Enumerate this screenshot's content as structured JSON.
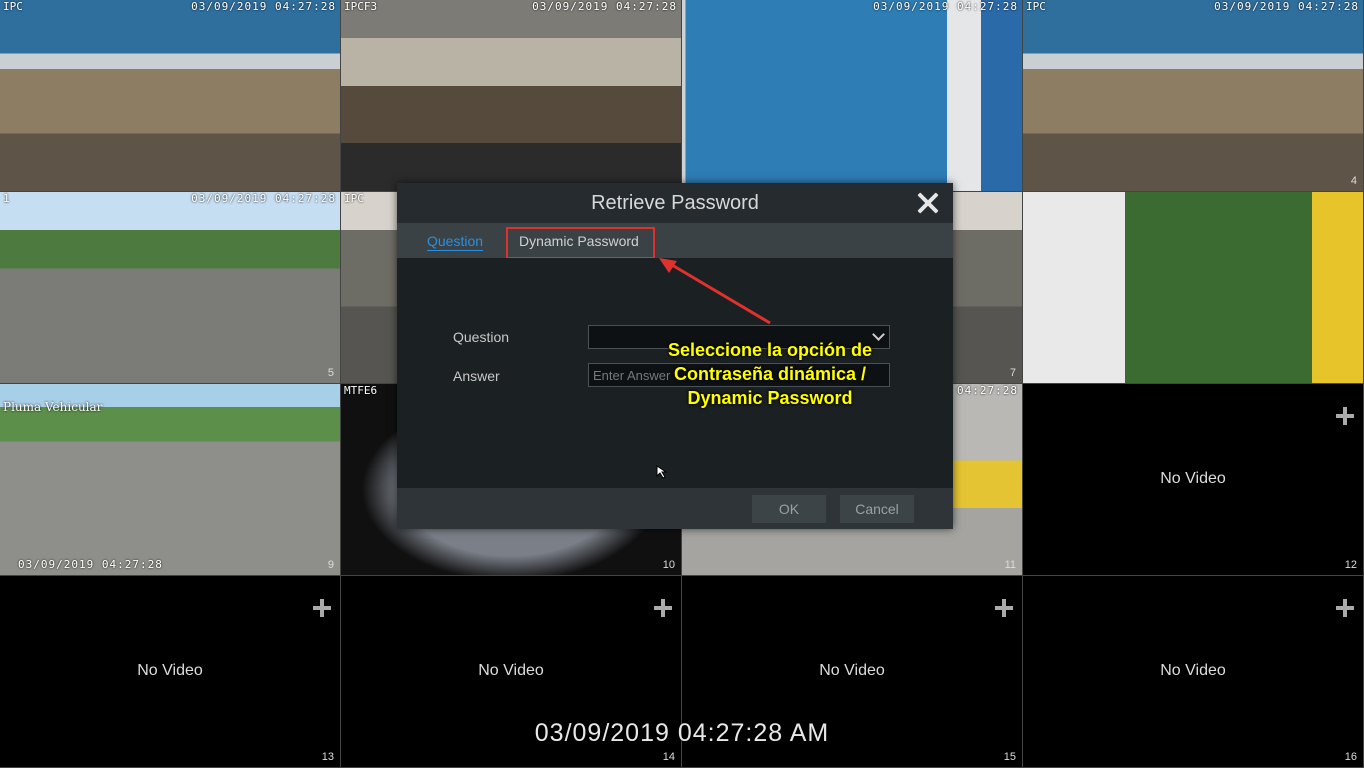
{
  "cameras": [
    {
      "label": "IPC",
      "timestamp": "03/09/2019 04:27:28",
      "number": "",
      "scene": "ceiling-blue"
    },
    {
      "label": "IPCF3",
      "timestamp": "03/09/2019 04:27:28",
      "number": "",
      "scene": "office"
    },
    {
      "label": "",
      "timestamp": "03/09/2019 04:27:28",
      "number": "",
      "scene": "bluewall"
    },
    {
      "label": "IPC",
      "timestamp": "03/09/2019 04:27:28",
      "number": "4",
      "scene": "ceiling-blue"
    },
    {
      "label": "1",
      "timestamp": "03/09/2019 04:27:28",
      "number": "5",
      "scene": "street"
    },
    {
      "label": "IPC",
      "timestamp": "",
      "number": "",
      "scene": "garage"
    },
    {
      "label": "",
      "timestamp": "",
      "number": "7",
      "scene": "garage"
    },
    {
      "label": "",
      "timestamp": "",
      "number": "",
      "scene": "wall-cams"
    },
    {
      "label": "Pluma Vehicular",
      "timestamp": "03/09/2019 04:27:28",
      "number": "9",
      "scene": "parking"
    },
    {
      "label": "MTFE6",
      "timestamp": "",
      "number": "10",
      "scene": "fisheye"
    },
    {
      "label": "",
      "timestamp": "04:27:28",
      "number": "11",
      "scene": "van"
    },
    {
      "label": "",
      "timestamp": "",
      "number": "12",
      "no_video": "No Video"
    },
    {
      "label": "",
      "timestamp": "",
      "number": "13",
      "no_video": "No Video"
    },
    {
      "label": "",
      "timestamp": "",
      "number": "14",
      "no_video": "No Video"
    },
    {
      "label": "",
      "timestamp": "",
      "number": "15",
      "no_video": "No Video"
    },
    {
      "label": "",
      "timestamp": "",
      "number": "16",
      "no_video": "No Video"
    }
  ],
  "dialog": {
    "title": "Retrieve Password",
    "tabs": {
      "question": "Question",
      "dynamic": "Dynamic Password"
    },
    "question_label": "Question",
    "answer_label": "Answer",
    "answer_placeholder": "Enter Answer",
    "ok": "OK",
    "cancel": "Cancel"
  },
  "annotation": {
    "line1": "Seleccione la opción de",
    "line2": "Contraseña dinámica /",
    "line3": "Dynamic Password",
    "color": "#ffff00",
    "arrow_color": "#e0312d"
  },
  "bottom_timestamp": "03/09/2019 04:27:28 AM",
  "icons": {
    "close": "close-icon",
    "add": "plus-icon",
    "dropdown": "chevron-down-icon",
    "cursor": "mouse-cursor-icon"
  }
}
